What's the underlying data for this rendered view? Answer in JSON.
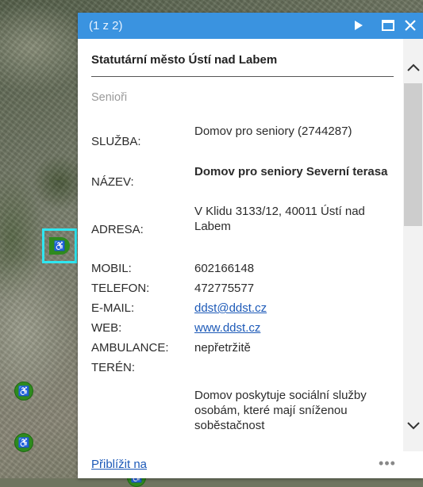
{
  "popup": {
    "pager": "(1 z 2)",
    "org_title": "Statutární město Ústí nad Labem",
    "layer_name": "Senioři",
    "fields": [
      {
        "label": "SLUŽBA:",
        "value": "Domov pro seniory (2744287)"
      },
      {
        "label": "NÁZEV:",
        "value": "Domov pro seniory Severní terasa"
      },
      {
        "label": "ADRESA:",
        "value": "V Klidu 3133/12, 40011 Ústí nad Labem"
      },
      {
        "label": "MOBIL:",
        "value": "602166148"
      },
      {
        "label": "TELEFON:",
        "value": "472775577"
      },
      {
        "label": "E-MAIL:",
        "value": "ddst@ddst.cz"
      },
      {
        "label": "WEB:",
        "value": "www.ddst.cz"
      },
      {
        "label": "AMBULANCE:",
        "value": "nepřetržitě"
      },
      {
        "label": "TERÉN:",
        "value": ""
      }
    ],
    "description": "Domov poskytuje sociální služby osobám, které mají sníženou soběstačnost",
    "zoom_link": "Přiblížit na",
    "more": "•••"
  },
  "map": {
    "marker_glyph": "♿"
  },
  "colors": {
    "header": "#3a93e0",
    "link": "#1d5ab8",
    "marker": "#2e8a1e",
    "selection": "#2fe6f0"
  },
  "icons": [
    "play-next-icon",
    "maximize-icon",
    "close-icon",
    "chevron-up-icon",
    "chevron-down-icon",
    "wheelchair-icon",
    "more-dots-icon"
  ]
}
